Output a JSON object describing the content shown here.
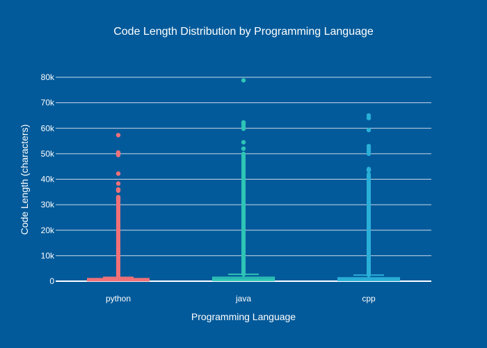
{
  "chart_data": {
    "type": "box",
    "title": "Code Length Distribution by Programming Language",
    "xlabel": "Programming Language",
    "ylabel": "Code Length (characters)",
    "ylim": [
      0,
      80000
    ],
    "yticks": [
      0,
      10000,
      20000,
      30000,
      40000,
      50000,
      60000,
      70000,
      80000
    ],
    "ytick_labels": [
      "0",
      "10k",
      "20k",
      "30k",
      "40k",
      "50k",
      "60k",
      "70k",
      "80k"
    ],
    "grid": true,
    "legend": "none",
    "categories": [
      "python",
      "java",
      "cpp"
    ],
    "series": [
      {
        "category": "python",
        "color": "#f07178",
        "q1": 200,
        "median": 600,
        "q3": 1000,
        "upper_fence": 1500,
        "dense_outliers_to": 31000,
        "outliers": [
          31500,
          32000,
          32500,
          33000,
          35500,
          36000,
          38300,
          42200,
          49500,
          50500,
          57300
        ]
      },
      {
        "category": "java",
        "color": "#2ec4b6",
        "q1": 300,
        "median": 800,
        "q3": 1500,
        "upper_fence": 2700,
        "dense_outliers_to": 50000,
        "outliers": [
          52000,
          54500,
          59800,
          60500,
          61500,
          62300,
          78800
        ]
      },
      {
        "category": "cpp",
        "color": "#2ab0d8",
        "q1": 300,
        "median": 700,
        "q3": 1300,
        "upper_fence": 2400,
        "dense_outliers_to": 42000,
        "outliers": [
          43500,
          44000,
          50000,
          51000,
          52000,
          53000,
          59300,
          64000,
          65000
        ]
      }
    ]
  }
}
